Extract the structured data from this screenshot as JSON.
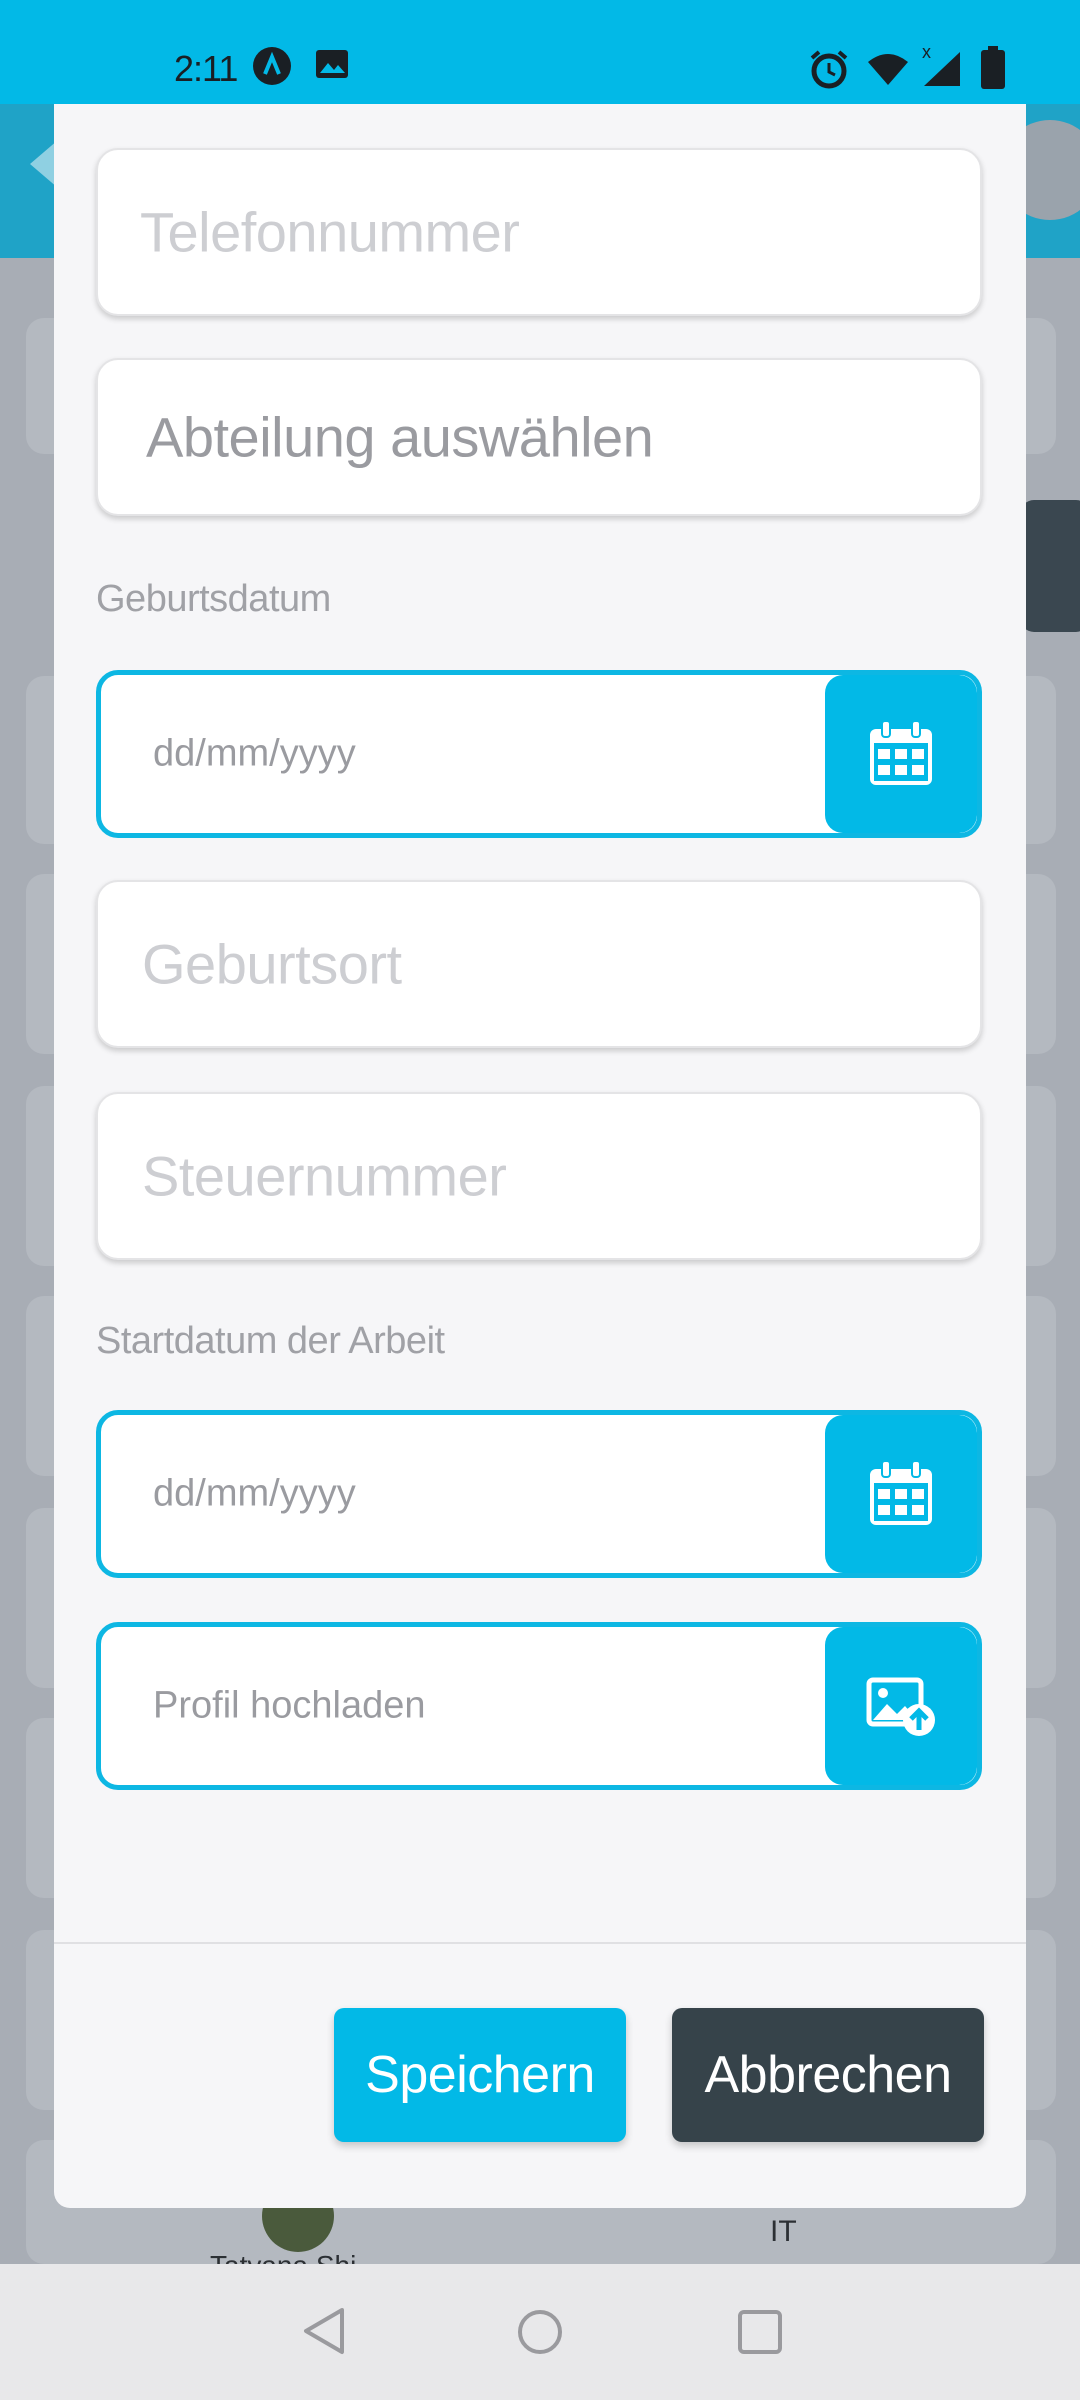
{
  "status_bar": {
    "time": "2:11",
    "icons": [
      "app-a-icon",
      "image-icon",
      "alarm-icon",
      "wifi-icon",
      "signal-icon",
      "battery-icon"
    ]
  },
  "background": {
    "list_item_name": "Tatyana Shi...",
    "list_item_department": "IT"
  },
  "form": {
    "phone_placeholder": "Telefonnummer",
    "department_placeholder": "Abteilung auswählen",
    "birthdate_label": "Geburtsdatum",
    "birthdate_placeholder": "dd/mm/yyyy",
    "birthplace_placeholder": "Geburtsort",
    "tax_number_placeholder": "Steuernummer",
    "start_date_label": "Startdatum der Arbeit",
    "start_date_placeholder": "dd/mm/yyyy",
    "profile_upload_placeholder": "Profil hochladen"
  },
  "footer": {
    "save_label": "Speichern",
    "cancel_label": "Abbrechen"
  },
  "colors": {
    "accent": "#02b9e7",
    "dark_button": "#36434a"
  }
}
